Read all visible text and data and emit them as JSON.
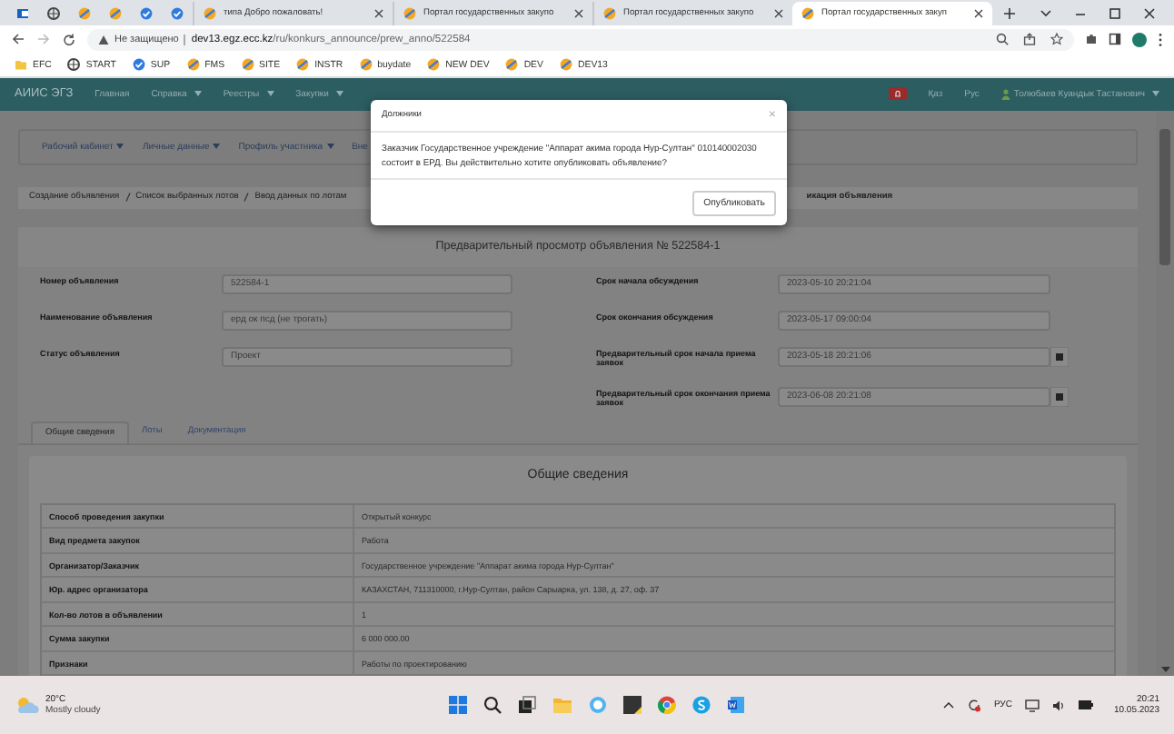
{
  "browser": {
    "tabs": [
      {
        "kind": "mail",
        "selected": false
      },
      {
        "kind": "globe",
        "selected": false
      },
      {
        "kind": "portal",
        "selected": false
      },
      {
        "kind": "portal",
        "selected": false
      },
      {
        "kind": "check",
        "selected": false
      },
      {
        "kind": "check",
        "selected": false
      },
      {
        "kind": "portal",
        "title": "типа Добро пожаловать!",
        "selected": false
      },
      {
        "kind": "portal",
        "title": "Портал государственных закупо",
        "selected": false
      },
      {
        "kind": "portal",
        "title": "Портал государственных закупо",
        "selected": false
      },
      {
        "kind": "portal",
        "title": "Портал государственных закуп",
        "selected": true
      }
    ],
    "address": {
      "security": "Не защищено",
      "host": "dev13.egz.ecc.kz",
      "path": "/ru/konkurs_announce/prew_anno/522584"
    },
    "bookmarks": [
      {
        "kind": "folder",
        "label": "EFC"
      },
      {
        "kind": "globe",
        "label": "START"
      },
      {
        "kind": "check",
        "label": "SUP"
      },
      {
        "kind": "portal",
        "label": "FMS"
      },
      {
        "kind": "portal",
        "label": "SITE"
      },
      {
        "kind": "portal",
        "label": "INSTR"
      },
      {
        "kind": "portal",
        "label": "buydate"
      },
      {
        "kind": "portal",
        "label": "NEW DEV"
      },
      {
        "kind": "portal",
        "label": "DEV"
      },
      {
        "kind": "portal",
        "label": "DEV13"
      }
    ]
  },
  "app_nav": {
    "brand": "АИИС ЭГЗ",
    "menu": [
      {
        "label": "Главная",
        "dropdown": false
      },
      {
        "label": "Справка",
        "dropdown": true
      },
      {
        "label": "Реестры",
        "dropdown": true
      },
      {
        "label": "Закупки",
        "dropdown": true
      }
    ],
    "languages": [
      "Қаз",
      "Рус"
    ],
    "user": "Толюбаев Куандык Тастанович"
  },
  "sub_nav": [
    {
      "label": "Рабочий кабинет",
      "dropdown": true
    },
    {
      "label": "Личные данные",
      "dropdown": true
    },
    {
      "label": "Профиль участника",
      "dropdown": true
    },
    {
      "label": "Вне",
      "dropdown": false
    }
  ],
  "breadcrumb": {
    "visible": [
      "Создание объявления",
      "Список выбранных лотов",
      "Ввод данных по лотам"
    ],
    "current": "икация объявления"
  },
  "panel": {
    "title": "Предварительный просмотр объявления № 522584-1",
    "left_fields": [
      {
        "label": "Номер объявления",
        "value": "522584-1"
      },
      {
        "label": "Наименование объявления",
        "value": "ерд ок псд (не трогать)"
      },
      {
        "label": "Статус объявления",
        "value": "Проект"
      }
    ],
    "right_fields": [
      {
        "label": "Срок начала обсуждения",
        "value": "2023-05-10 20:21:04",
        "calendar": false
      },
      {
        "label": "Срок окончания обсуждения",
        "value": "2023-05-17 09:00:04",
        "calendar": false
      },
      {
        "label": "Предварительный срок начала приема заявок",
        "value": "2023-05-18 20:21:06",
        "calendar": true
      },
      {
        "label": "Предварительный срок окончания приема заявок",
        "value": "2023-06-08 20:21:08",
        "calendar": true
      }
    ],
    "tabs": [
      {
        "label": "Общие сведения",
        "selected": true
      },
      {
        "label": "Лоты",
        "selected": false
      },
      {
        "label": "Документация",
        "selected": false
      }
    ],
    "section": {
      "title": "Общие сведения",
      "rows": [
        {
          "label": "Способ проведения закупки",
          "value": "Открытый конкурс"
        },
        {
          "label": "Вид предмета закупок",
          "value": "Работа"
        },
        {
          "label": "Организатор/Заказчик",
          "value": "Государственное учреждение \"Аппарат акима города Нур-Султан\""
        },
        {
          "label": "Юр. адрес организатора",
          "value": "КАЗАХСТАН, 711310000, г.Нур-Султан, район Сарыарка, ул. 138, д. 27, оф. 37"
        },
        {
          "label": "Кол-во лотов в объявлении",
          "value": "1"
        },
        {
          "label": "Сумма закупки",
          "value": "6 000 000.00"
        },
        {
          "label": "Признаки",
          "value": "Работы по проектированию"
        }
      ]
    }
  },
  "dialog": {
    "title": "Должники",
    "close": "×",
    "message": "Заказчик Государственное учреждение \"Аппарат акима города Нур-Султан\" 010140002030 состоит в ЕРД. Вы действительно хотите опубликовать объявление?",
    "button": "Опубликовать"
  },
  "taskbar": {
    "weather": {
      "temperature": "20°C",
      "condition": "Mostly cloudy"
    },
    "language": "РУС",
    "time": "20:21",
    "date": "10.05.2023"
  }
}
